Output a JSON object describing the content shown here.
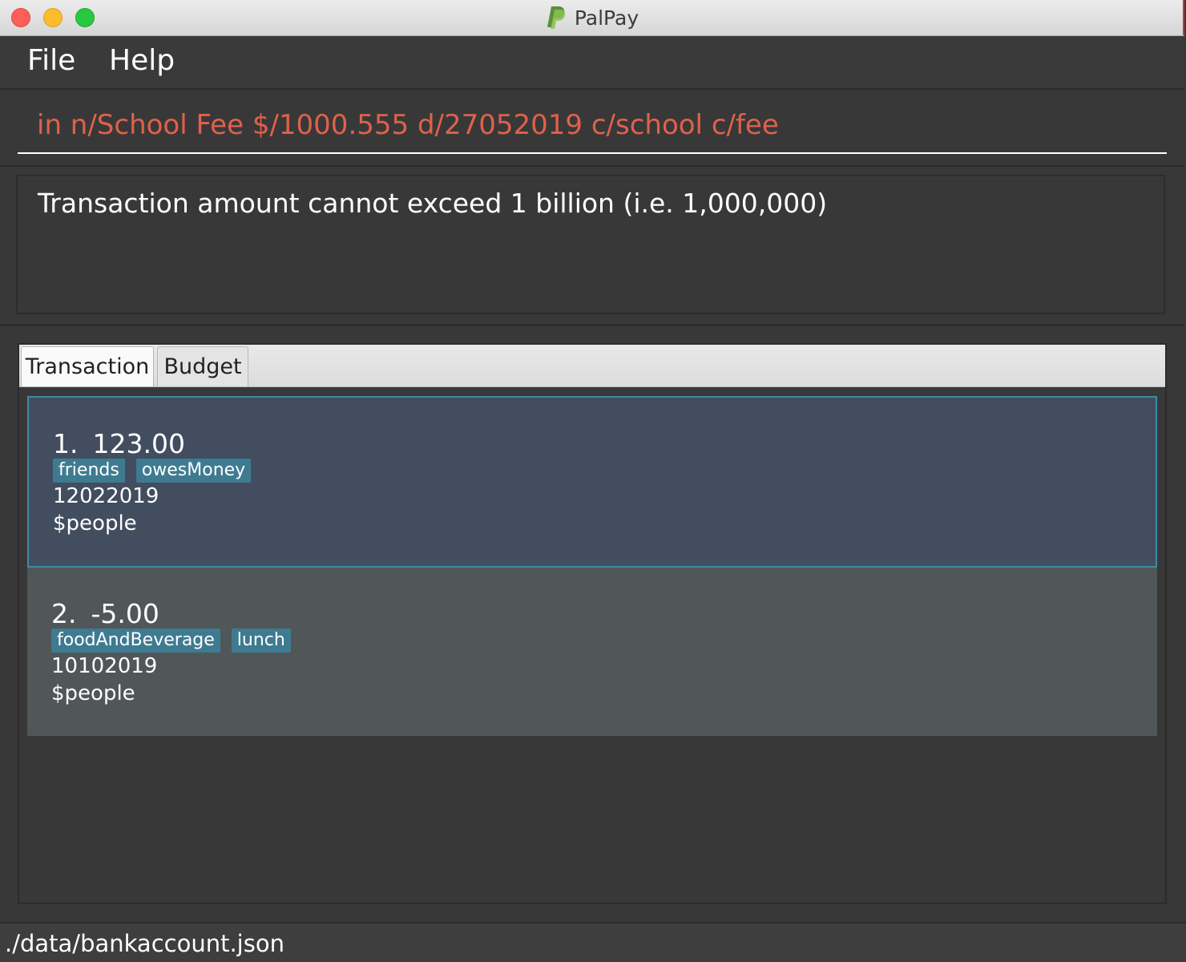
{
  "window": {
    "title": "PalPay"
  },
  "menu": {
    "file": "File",
    "help": "Help"
  },
  "command": {
    "value": "in n/School Fee $/1000.555 d/27052019 c/school c/fee"
  },
  "result": {
    "message": "Transaction amount cannot exceed 1 billion (i.e. 1,000,000)"
  },
  "tabs": [
    {
      "label": "Transaction",
      "active": true
    },
    {
      "label": "Budget",
      "active": false
    }
  ],
  "transactions": [
    {
      "index": "1.",
      "amount": "123.00",
      "tags": [
        "friends",
        "owesMoney"
      ],
      "date": "12022019",
      "description": "$people",
      "selected": true
    },
    {
      "index": "2.",
      "amount": "-5.00",
      "tags": [
        "foodAndBeverage",
        "lunch"
      ],
      "date": "10102019",
      "description": "$people",
      "selected": false
    }
  ],
  "status": {
    "file_path": "./data/bankaccount.json"
  },
  "colors": {
    "command_text": "#e0614a",
    "selected_card": "#424d5f",
    "card": "#515658",
    "tag": "#3e7b91",
    "background": "#383838"
  },
  "icons": {
    "app_logo": "paypal-logo-icon"
  }
}
